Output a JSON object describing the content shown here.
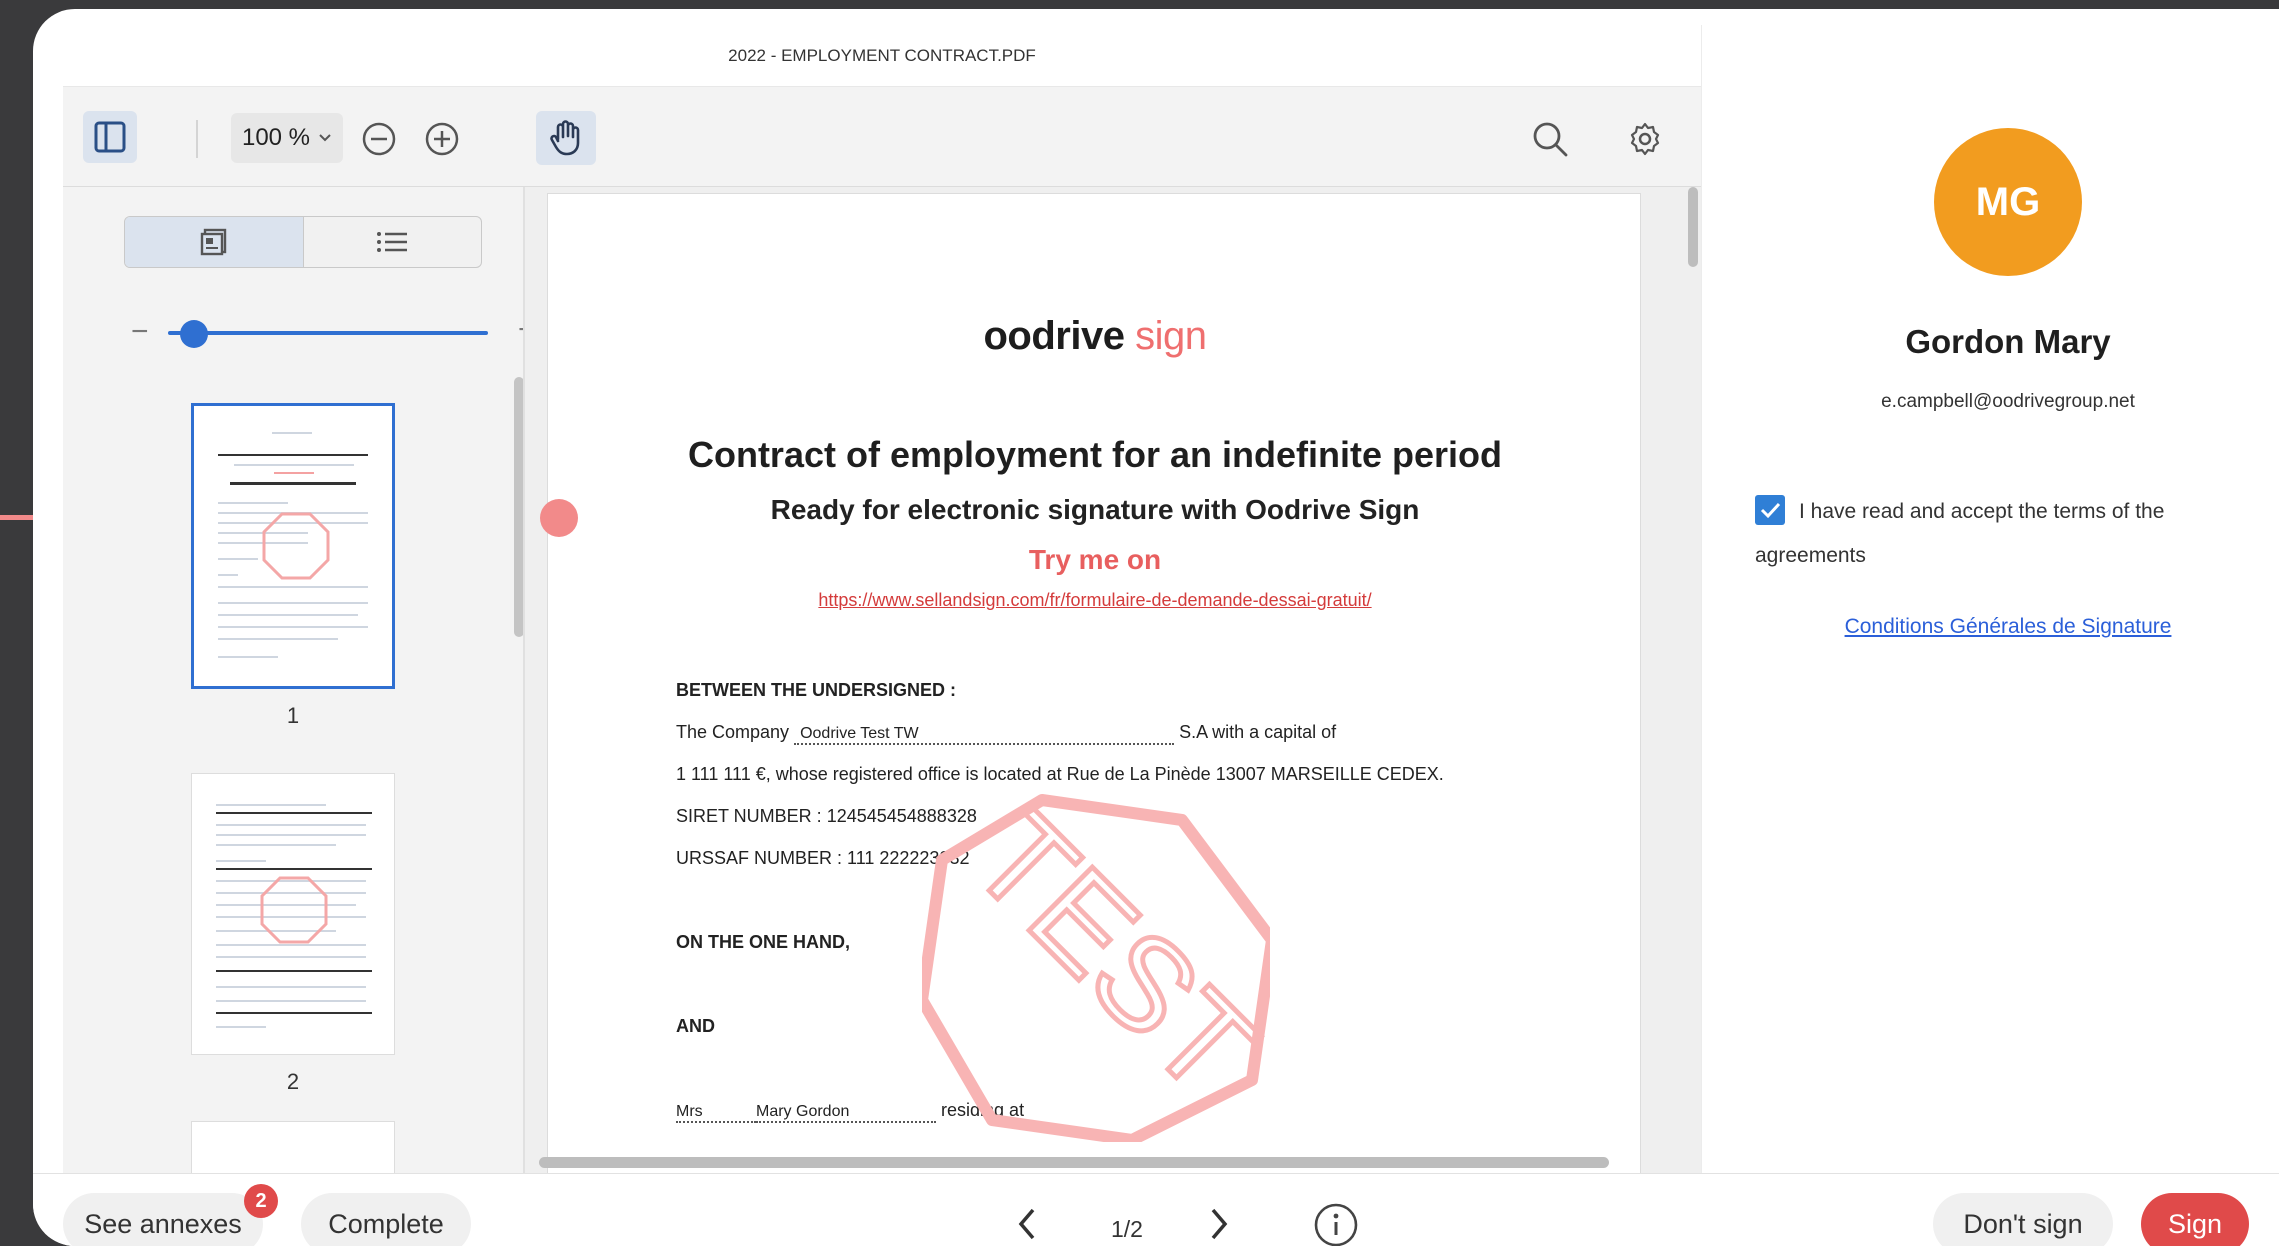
{
  "viewer": {
    "file_title": "2022 - EMPLOYMENT CONTRACT.PDF",
    "zoom": "100 %",
    "thumbnails": [
      {
        "page": "1",
        "selected": true
      },
      {
        "page": "2",
        "selected": false
      }
    ]
  },
  "document": {
    "logo_main": "oodrive",
    "logo_accent": "sign",
    "title": "Contract of employment for an indefinite period",
    "subtitle": "Ready for electronic signature with Oodrive Sign",
    "try_label": "Try me on",
    "link": "https://www.sellandsign.com/fr/formulaire-de-demande-dessai-gratuit/",
    "between_heading": "BETWEEN THE UNDERSIGNED :",
    "company_prefix": "The Company",
    "company_name": "Oodrive Test TW",
    "company_suffix": "S.A with a capital of",
    "capital_line": "1 111 111 €, whose registered office is located at Rue de La Pinède 13007 MARSEILLE CEDEX.",
    "siret": "SIRET NUMBER : 124545454888328",
    "urssaf": "URSSAF NUMBER : 111 222223332",
    "one_hand": "ON THE ONE HAND,",
    "and": "AND",
    "title_mrs": "Mrs",
    "employee_name": "Mary Gordon",
    "residing": "residing at",
    "stamp_text": "TEST"
  },
  "signer": {
    "initials": "MG",
    "name": "Gordon Mary",
    "email": "e.campbell@oodrivegroup.net",
    "agree_text": "I have read and accept the terms of the agreements",
    "agree_checked": true,
    "terms_link": "Conditions Générales de Signature",
    "avatar_color": "#f29c1f"
  },
  "bottom": {
    "see_annexes": "See annexes",
    "annex_count": "2",
    "complete": "Complete",
    "page_indicator": "1/2",
    "dont_sign": "Don't sign",
    "sign": "Sign"
  },
  "colors": {
    "accent": "#2f6fd1",
    "brand_red": "#e04a4a"
  }
}
